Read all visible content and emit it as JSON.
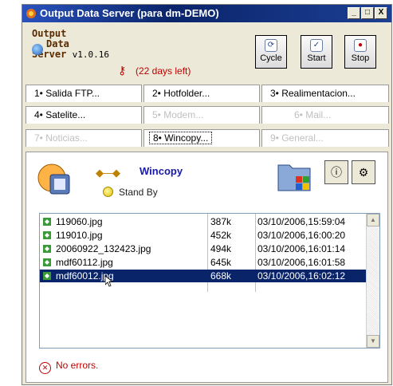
{
  "window": {
    "title": "Output Data Server (para dm-DEMO)",
    "controls": {
      "minimize": "_",
      "maximize": "□",
      "close": "X"
    }
  },
  "header": {
    "logo_line1": "Output",
    "logo_line2": "Data",
    "logo_line3": "Server",
    "version": "v1.0.16",
    "license_status": "(22 days left)",
    "buttons": [
      {
        "label": "Cycle",
        "icon": "cycle-icon"
      },
      {
        "label": "Start",
        "icon": "checkmark-icon"
      },
      {
        "label": "Stop",
        "icon": "stop-icon"
      }
    ]
  },
  "tabs": [
    {
      "label": "1• Salida FTP...",
      "enabled": true
    },
    {
      "label": "2• Hotfolder...",
      "enabled": true
    },
    {
      "label": "3• Realimentacion...",
      "enabled": true
    },
    {
      "label": "4• Satelite...",
      "enabled": true
    },
    {
      "label": "5• Modem...",
      "enabled": false
    },
    {
      "label": "6• Mail...",
      "enabled": false
    },
    {
      "label": "7• Noticias...",
      "enabled": false
    },
    {
      "label": "8• Wincopy...",
      "enabled": true,
      "selected": true
    },
    {
      "label": "9• General...",
      "enabled": false
    }
  ],
  "panel": {
    "name": "Wincopy",
    "status": "Stand By",
    "files": [
      {
        "name": "119060.jpg",
        "size": "387k",
        "date": "03/10/2006,15:59:04"
      },
      {
        "name": "119010.jpg",
        "size": "452k",
        "date": "03/10/2006,16:00:20"
      },
      {
        "name": "20060922_132423.jpg",
        "size": "494k",
        "date": "03/10/2006,16:01:14"
      },
      {
        "name": "mdf60112.jpg",
        "size": "645k",
        "date": "03/10/2006,16:01:58"
      },
      {
        "name": "mdf60012.jpg",
        "size": "668k",
        "date": "03/10/2006,16:02:12",
        "selected": true
      }
    ],
    "error_text": "No errors."
  },
  "colors": {
    "title_bar": "#0a246a",
    "selection": "#0a246a",
    "accent_name": "#1a1aa8",
    "error": "#c00000"
  }
}
